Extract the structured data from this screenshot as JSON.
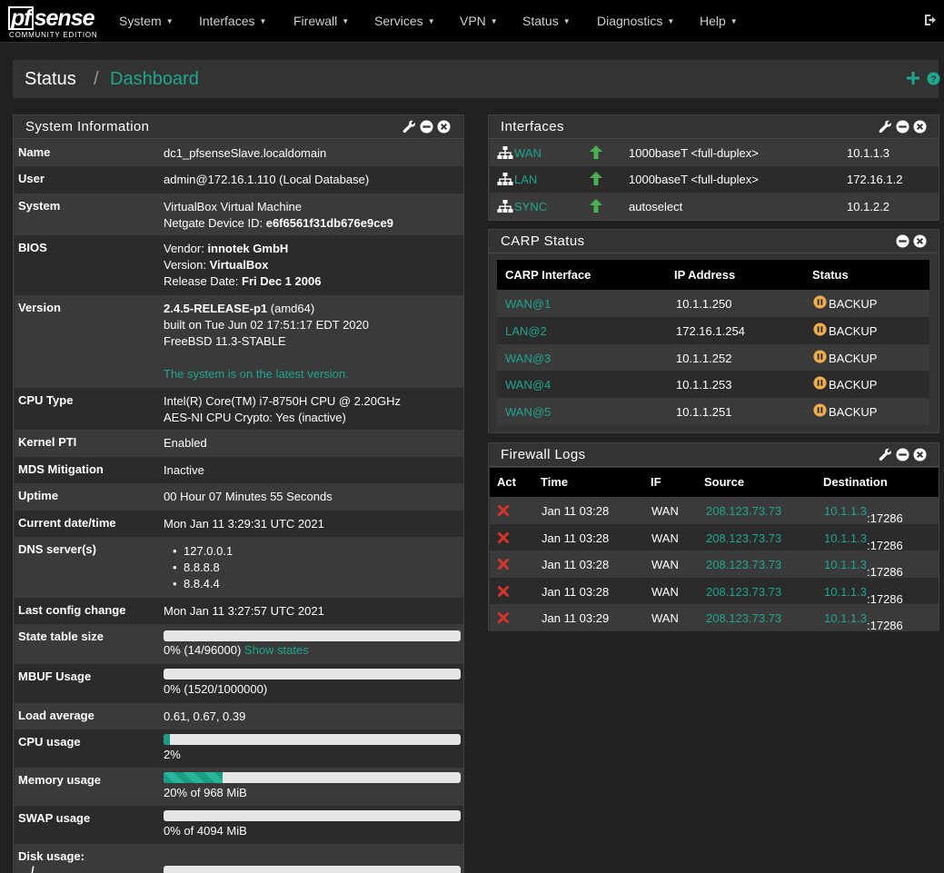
{
  "brand": {
    "logo_main": "sense",
    "logo_pf": "pf",
    "edition": "COMMUNITY EDITION"
  },
  "nav": [
    "System",
    "Interfaces",
    "Firewall",
    "Services",
    "VPN",
    "Status",
    "Diagnostics",
    "Help"
  ],
  "breadcrumb": {
    "section": "Status",
    "separator": "/",
    "page": "Dashboard"
  },
  "system_info": {
    "title": "System Information",
    "name": {
      "label": "Name",
      "value": "dc1_pfsenseSlave.localdomain"
    },
    "user": {
      "label": "User",
      "value": "admin@172.16.1.110 (Local Database)"
    },
    "system": {
      "label": "System",
      "line1": "VirtualBox Virtual Machine",
      "line2_prefix": "Netgate Device ID: ",
      "line2_value": "e6f6561f31db676e9ce9"
    },
    "bios": {
      "label": "BIOS",
      "vendor_prefix": "Vendor: ",
      "vendor": "innotek GmbH",
      "version_prefix": "Version: ",
      "version": "VirtualBox",
      "date_prefix": "Release Date: ",
      "date": "Fri Dec 1 2006"
    },
    "version": {
      "label": "Version",
      "release": "2.4.5-RELEASE-p1",
      "arch": " (amd64)",
      "built": "built on Tue Jun 02 17:51:17 EDT 2020",
      "os": "FreeBSD 11.3-STABLE",
      "status": "The system is on the latest version."
    },
    "cpu_type": {
      "label": "CPU Type",
      "line1": "Intel(R) Core(TM) i7-8750H CPU @ 2.20GHz",
      "line2": "AES-NI CPU Crypto: Yes (inactive)"
    },
    "kernel_pti": {
      "label": "Kernel PTI",
      "value": "Enabled"
    },
    "mds": {
      "label": "MDS Mitigation",
      "value": "Inactive"
    },
    "uptime": {
      "label": "Uptime",
      "value": "00 Hour 07 Minutes 55 Seconds"
    },
    "datetime": {
      "label": "Current date/time",
      "value": "Mon Jan 11 3:29:31 UTC 2021"
    },
    "dns": {
      "label": "DNS server(s)",
      "servers": [
        "127.0.0.1",
        "8.8.8.8",
        "8.8.4.4"
      ]
    },
    "last_config": {
      "label": "Last config change",
      "value": "Mon Jan 11 3:27:57 UTC 2021"
    },
    "state_table": {
      "label": "State table size",
      "text": "0% (14/96000)",
      "link": "Show states",
      "fraction": 0.0
    },
    "mbuf": {
      "label": "MBUF Usage",
      "text": "0% (1520/1000000)",
      "fraction": 0.0
    },
    "load": {
      "label": "Load average",
      "value": "0.61, 0.67, 0.39"
    },
    "cpu_usage": {
      "label": "CPU usage",
      "text": "2%",
      "fraction": 0.02
    },
    "memory": {
      "label": "Memory usage",
      "text": "20% of 968 MiB",
      "fraction": 0.2
    },
    "swap": {
      "label": "SWAP usage",
      "text": "0% of 4094 MiB",
      "fraction": 0.0
    },
    "disk": {
      "label": "Disk usage:",
      "mount": "/"
    }
  },
  "interfaces": {
    "title": "Interfaces",
    "rows": [
      {
        "name": "WAN",
        "media": "1000baseT <full-duplex>",
        "ip": "10.1.1.3"
      },
      {
        "name": "LAN",
        "media": "1000baseT <full-duplex>",
        "ip": "172.16.1.2"
      },
      {
        "name": "SYNC",
        "media": "autoselect",
        "ip": "10.1.2.2"
      }
    ]
  },
  "carp": {
    "title": "CARP Status",
    "headers": [
      "CARP Interface",
      "IP Address",
      "Status"
    ],
    "rows": [
      {
        "iface": "WAN@1",
        "ip": "10.1.1.250",
        "status": "BACKUP"
      },
      {
        "iface": "LAN@2",
        "ip": "172.16.1.254",
        "status": "BACKUP"
      },
      {
        "iface": "WAN@3",
        "ip": "10.1.1.252",
        "status": "BACKUP"
      },
      {
        "iface": "WAN@4",
        "ip": "10.1.1.253",
        "status": "BACKUP"
      },
      {
        "iface": "WAN@5",
        "ip": "10.1.1.251",
        "status": "BACKUP"
      }
    ]
  },
  "firewall_logs": {
    "title": "Firewall Logs",
    "headers": [
      "Act",
      "Time",
      "IF",
      "Source",
      "Destination"
    ],
    "rows": [
      {
        "time": "Jan 11 03:28",
        "iface": "WAN",
        "source": "208.123.73.73",
        "dest_ip": "10.1.1.3",
        "dest_port": ":17286"
      },
      {
        "time": "Jan 11 03:28",
        "iface": "WAN",
        "source": "208.123.73.73",
        "dest_ip": "10.1.1.3",
        "dest_port": ":17286"
      },
      {
        "time": "Jan 11 03:28",
        "iface": "WAN",
        "source": "208.123.73.73",
        "dest_ip": "10.1.1.3",
        "dest_port": ":17286"
      },
      {
        "time": "Jan 11 03:28",
        "iface": "WAN",
        "source": "208.123.73.73",
        "dest_ip": "10.1.1.3",
        "dest_port": ":17286"
      },
      {
        "time": "Jan 11 03:29",
        "iface": "WAN",
        "source": "208.123.73.73",
        "dest_ip": "10.1.1.3",
        "dest_port": ":17286"
      }
    ]
  },
  "colors": {
    "accent": "#1ea68f",
    "up_arrow": "#4caf50",
    "block": "#d9342b",
    "backup": "#f0ad4e",
    "panel": "#333333",
    "navbar": "#000000"
  },
  "icons": {
    "wrench": "wrench-icon",
    "minus": "minus-circle-icon",
    "close": "close-circle-icon",
    "plus": "plus-icon",
    "help": "help-icon",
    "logout": "logout-icon",
    "network": "sitemap-icon",
    "up": "arrow-up-icon",
    "pause": "pause-circle-icon",
    "block": "times-icon"
  }
}
